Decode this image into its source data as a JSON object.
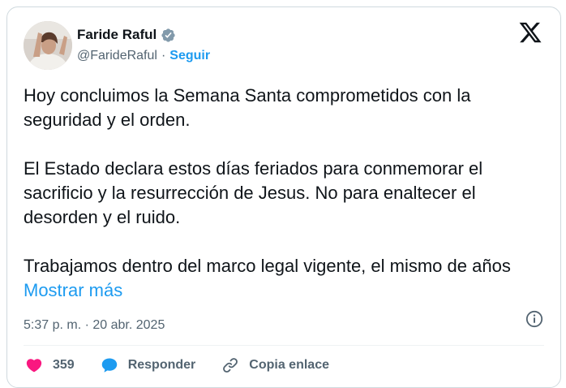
{
  "author": {
    "name": "Faride Raful",
    "handle": "@FarideRaful",
    "separator": "·",
    "follow_label": "Seguir",
    "verified_color": "#829aab"
  },
  "brand": {
    "logo": "x-logo-icon"
  },
  "tweet": {
    "paragraphs": [
      "Hoy concluimos la Semana Santa comprometidos con la seguridad y el orden.",
      "El Estado declara estos días feriados para conmemorar el sacrificio y la resurrección de Jesus. No para enaltecer el desorden y el ruido.",
      "Trabajamos dentro del marco legal vigente, el mismo de años"
    ],
    "show_more": "Mostrar más",
    "timestamp": "5:37 p. m. · 20 abr. 2025"
  },
  "actions": {
    "like_count": "359",
    "reply_label": "Responder",
    "copy_label": "Copia enlace"
  },
  "colors": {
    "accent": "#1d9bf0",
    "like": "#f91880",
    "text": "#0f1419",
    "muted": "#536471",
    "border": "#cfd9de"
  }
}
